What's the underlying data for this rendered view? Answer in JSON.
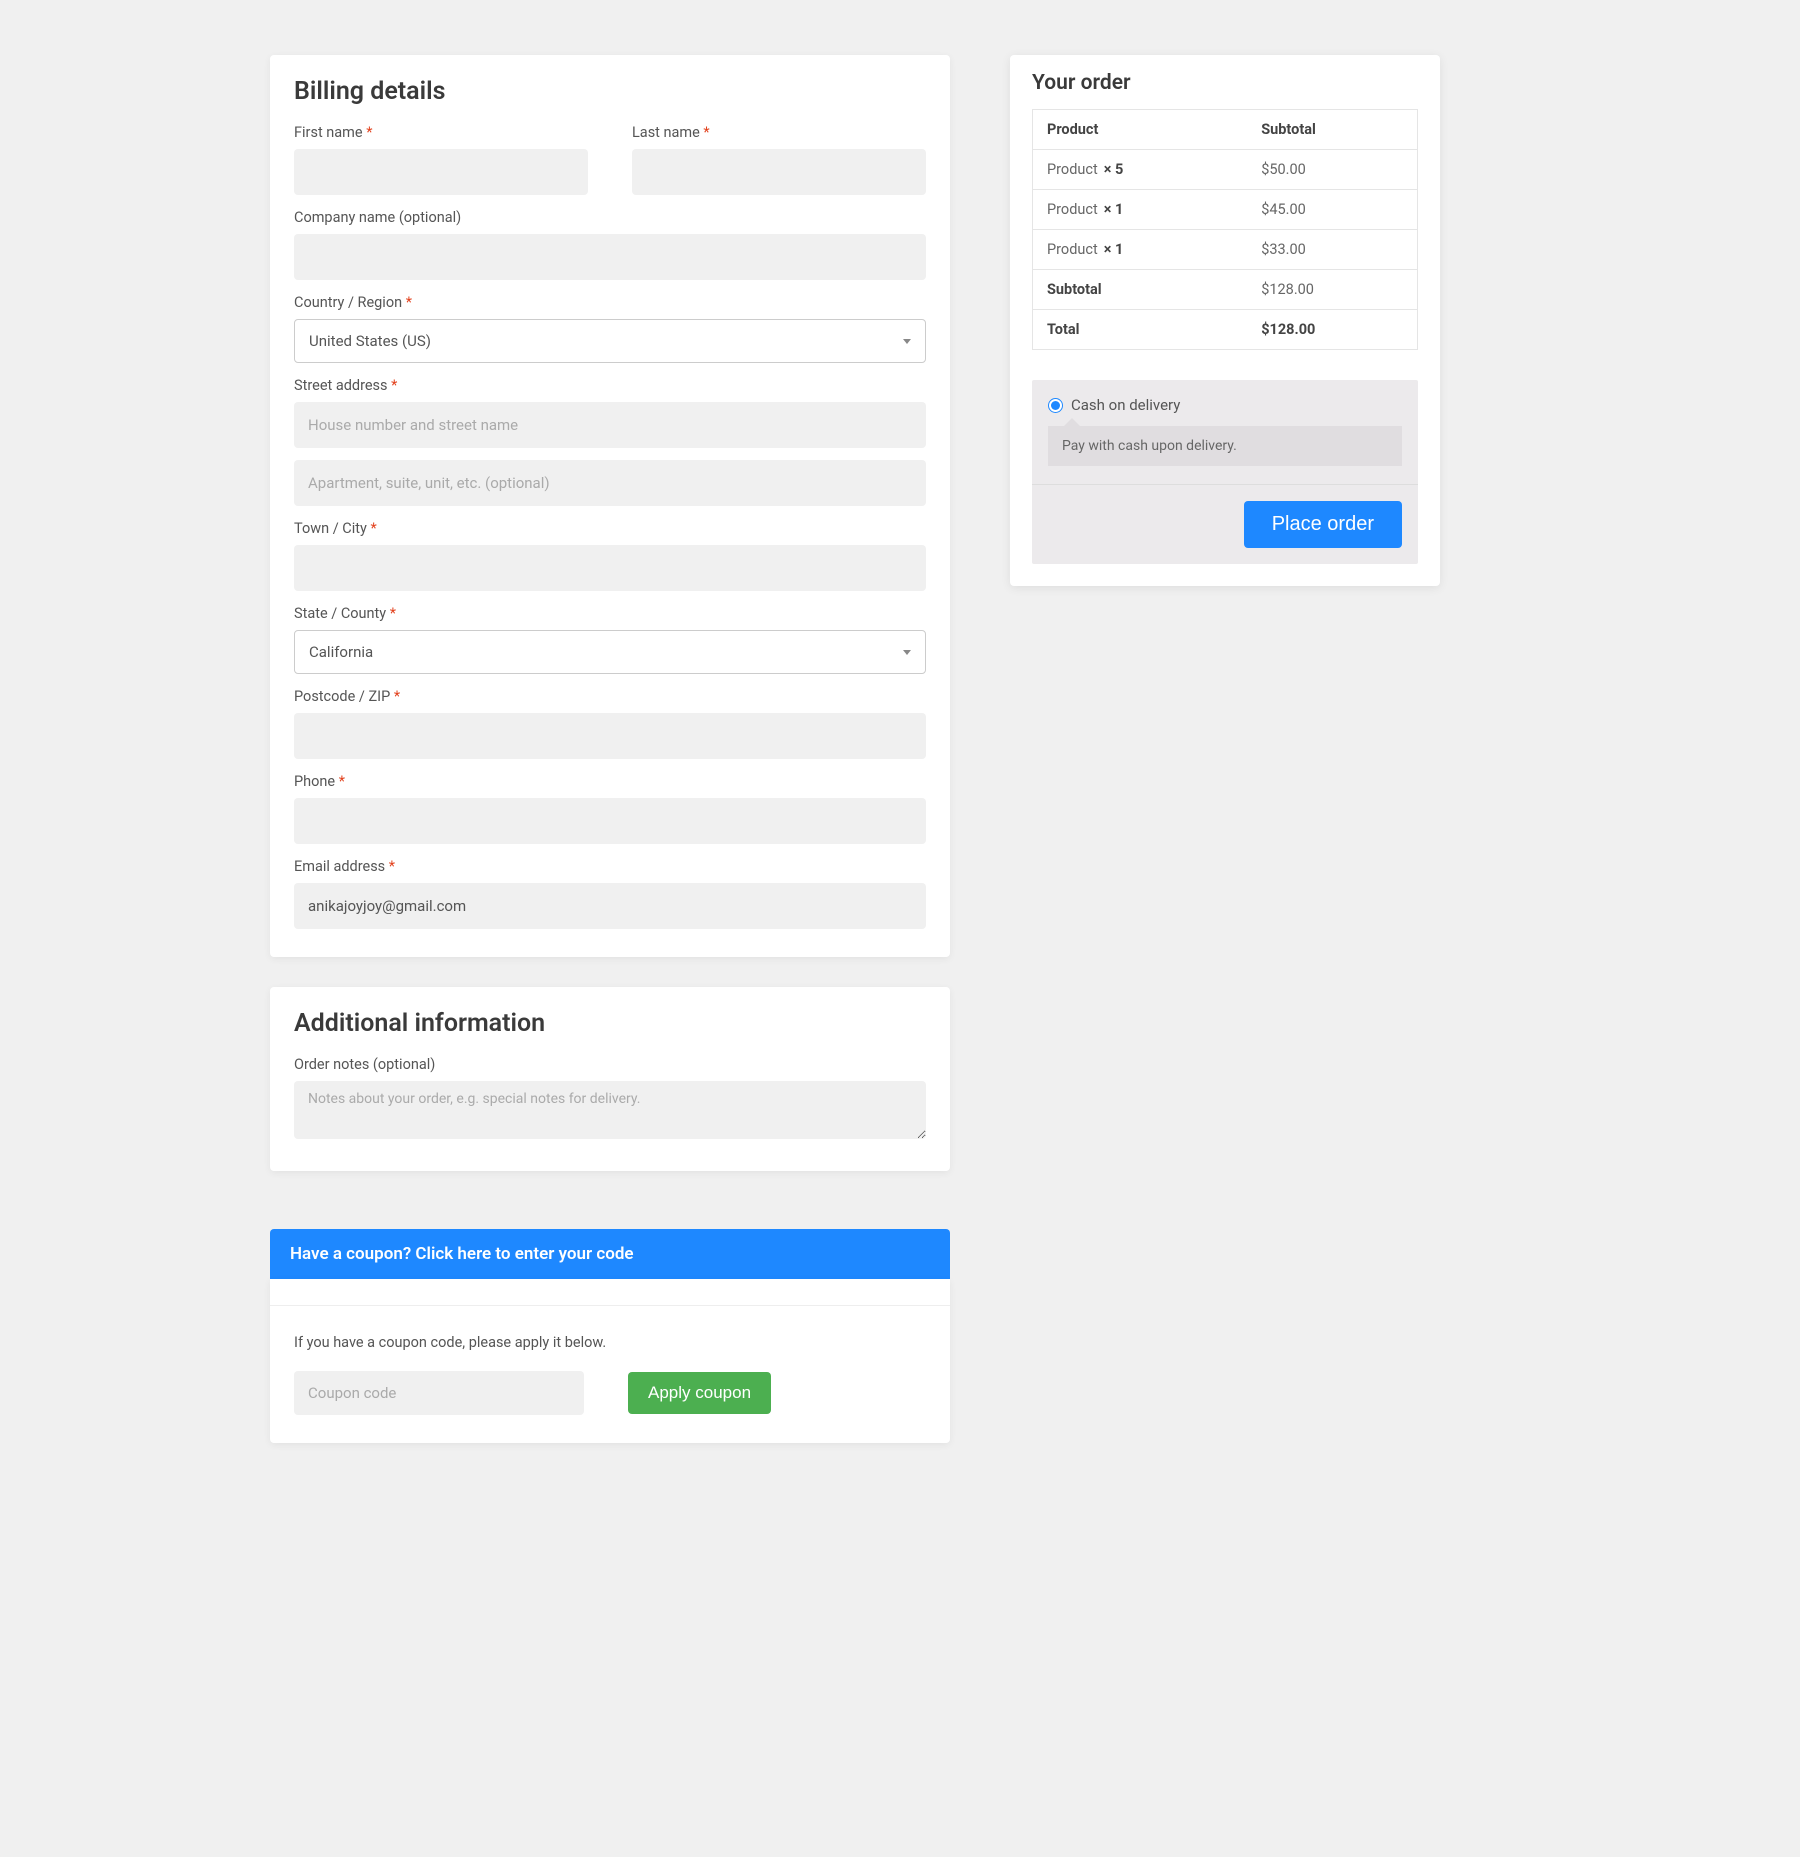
{
  "billing": {
    "title": "Billing details",
    "first_name": {
      "label": "First name ",
      "value": ""
    },
    "last_name": {
      "label": "Last name ",
      "value": ""
    },
    "company": {
      "label": "Company name (optional)",
      "value": ""
    },
    "country": {
      "label": "Country / Region ",
      "value": "United States (US)"
    },
    "street": {
      "label": "Street address ",
      "placeholder1": "House number and street name",
      "placeholder2": "Apartment, suite, unit, etc. (optional)"
    },
    "city": {
      "label": "Town / City ",
      "value": ""
    },
    "state": {
      "label": "State / County ",
      "value": "California"
    },
    "postcode": {
      "label": "Postcode / ZIP ",
      "value": ""
    },
    "phone": {
      "label": "Phone ",
      "value": ""
    },
    "email": {
      "label": "Email address ",
      "value": "anikajoyjoy@gmail.com"
    }
  },
  "additional": {
    "title": "Additional information",
    "notes_label": "Order notes (optional)",
    "notes_placeholder": "Notes about your order, e.g. special notes for delivery."
  },
  "coupon": {
    "bar_text": "Have a coupon? Click here to enter your code",
    "hint": "If you have a coupon code, please apply it below.",
    "placeholder": "Coupon code",
    "apply_label": "Apply coupon"
  },
  "order": {
    "title": "Your order",
    "header_product": "Product",
    "header_subtotal": "Subtotal",
    "items": [
      {
        "name": "Product",
        "qty": "× 5",
        "subtotal": "$50.00"
      },
      {
        "name": "Product",
        "qty": "× 1",
        "subtotal": "$45.00"
      },
      {
        "name": "Product",
        "qty": "× 1",
        "subtotal": "$33.00"
      }
    ],
    "subtotal_label": "Subtotal",
    "subtotal_value": "$128.00",
    "total_label": "Total",
    "total_value": "$128.00"
  },
  "payment": {
    "method_label": "Cash on delivery",
    "method_desc": "Pay with cash upon delivery.",
    "place_order_label": "Place order"
  },
  "required_mark": "*"
}
